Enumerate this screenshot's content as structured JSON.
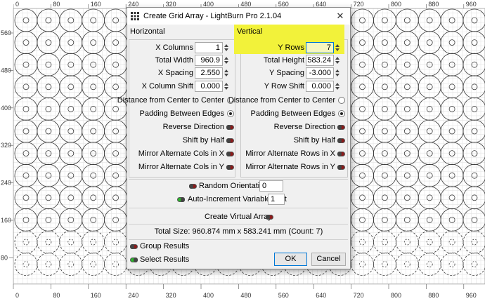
{
  "colors": {
    "highlight": "#f2f23a",
    "grid_line": "#e4e4e4",
    "circle_stroke": "#3a3a3a",
    "accent": "#0078d7",
    "toggle_on": "#2db52d",
    "toggle_off": "#8b1a1a"
  },
  "rulers": {
    "top": [
      "0",
      "80",
      "160",
      "240",
      "320",
      "400",
      "480",
      "560",
      "640",
      "720",
      "800",
      "880",
      "960"
    ],
    "left": [
      "560",
      "480",
      "400",
      "320",
      "240",
      "160",
      "80"
    ],
    "bottom": [
      "0",
      "80",
      "160",
      "240",
      "320",
      "400",
      "480",
      "560",
      "640",
      "720",
      "800",
      "880",
      "960"
    ]
  },
  "dialog": {
    "title": "Create Grid Array - LightBurn Pro 2.1.04",
    "close": "✕",
    "horizontal": {
      "header": "Horizontal",
      "columns_label": "X Columns",
      "columns_value": "1",
      "total_width_label": "Total Width",
      "total_width_value": "960.9",
      "spacing_label": "X Spacing",
      "spacing_value": "2.550",
      "shift_label": "X Column Shift",
      "shift_value": "0.000",
      "dist_center_label": "Distance from Center to Center",
      "padding_label": "Padding Between Edges",
      "reverse_label": "Reverse Direction",
      "shift_half_label": "Shift by Half",
      "mirror_x_label": "Mirror Alternate Cols in X",
      "mirror_y_label": "Mirror Alternate Cols in Y"
    },
    "vertical": {
      "header": "Vertical",
      "rows_label": "Y Rows",
      "rows_value": "7",
      "total_height_label": "Total Height",
      "total_height_value": "583.24",
      "spacing_label": "Y Spacing",
      "spacing_value": "-3.000",
      "shift_label": "Y Row Shift",
      "shift_value": "0.000",
      "dist_center_label": "Distance from Center to Center",
      "padding_label": "Padding Between Edges",
      "reverse_label": "Reverse Direction",
      "shift_half_label": "Shift by Half",
      "mirror_x_label": "Mirror Alternate Rows in X",
      "mirror_y_label": "Mirror Alternate Rows in Y"
    },
    "random_orientation_label": "Random Orientation",
    "random_orientation_value": "0",
    "auto_increment_label": "Auto-Increment Variable Text",
    "auto_increment_value": "1",
    "virtual_array_label": "Create Virtual Array",
    "total_size_text": "Total Size: 960.874 mm x 583.241 mm  (Count: 7)",
    "group_results_label": "Group Results",
    "select_results_label": "Select Results",
    "ok_label": "OK",
    "cancel_label": "Cancel"
  }
}
